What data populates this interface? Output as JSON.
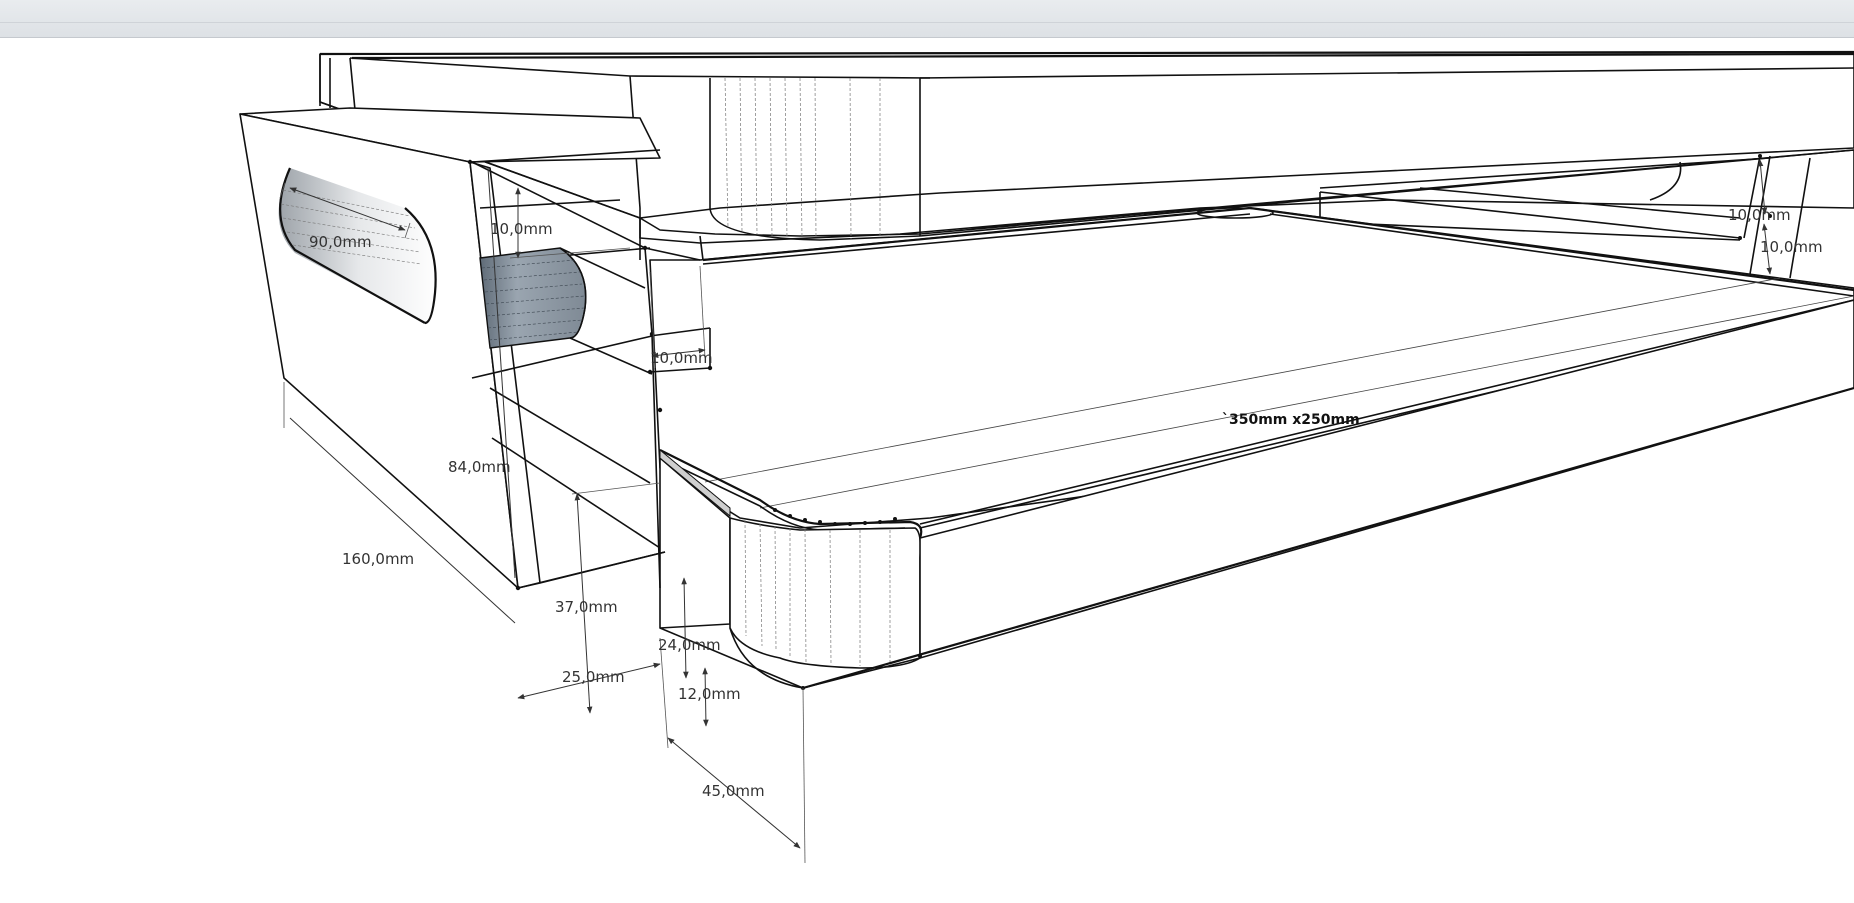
{
  "model": {
    "tray_label": "`350mm x250mm"
  },
  "dimensions": {
    "d90": "90,0mm",
    "d10_left": "10,0mm",
    "d10_mid": "10,0mm",
    "d84": "84,0mm",
    "d160": "160,0mm",
    "d37": "37,0mm",
    "d25": "25,0mm",
    "d24": "24,0mm",
    "d12": "12,0mm",
    "d45": "45,0mm",
    "d10_right_a": "10,0mm",
    "d10_right_b": "10,0mm"
  },
  "colors": {
    "edge": "#111111",
    "cylinder": "#8c97a2",
    "toolbar": "#e3e6ea"
  }
}
